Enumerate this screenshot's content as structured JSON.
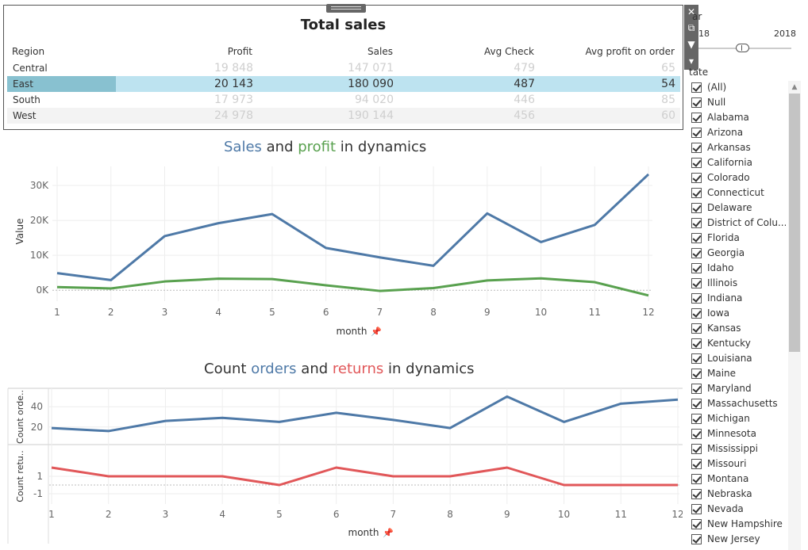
{
  "table": {
    "title": "Total sales",
    "headers": {
      "region": "Region",
      "profit": "Profit",
      "sales": "Sales",
      "avg_check": "Avg Check",
      "avg_profit": "Avg profit on order"
    },
    "rows": [
      {
        "region": "Central",
        "profit": "19 848",
        "sales": "147 071",
        "avg_check": "479",
        "avg_profit": "65"
      },
      {
        "region": "East",
        "profit": "20 143",
        "sales": "180 090",
        "avg_check": "487",
        "avg_profit": "54"
      },
      {
        "region": "South",
        "profit": "17 973",
        "sales": "94 020",
        "avg_check": "446",
        "avg_profit": "85"
      },
      {
        "region": "West",
        "profit": "24 978",
        "sales": "190 144",
        "avg_check": "456",
        "avg_profit": "60"
      }
    ],
    "selected_row": "East"
  },
  "tools": {
    "close": "✕",
    "popout": "⧉",
    "filter": "▼",
    "menu": "▾"
  },
  "filters": {
    "year_label": "ar",
    "year_min": "18",
    "year_max": "2018",
    "state_label": "tate",
    "states": [
      "(All)",
      "Null",
      "Alabama",
      "Arizona",
      "Arkansas",
      "California",
      "Colorado",
      "Connecticut",
      "Delaware",
      "District of Colu...",
      "Florida",
      "Georgia",
      "Idaho",
      "Illinois",
      "Indiana",
      "Iowa",
      "Kansas",
      "Kentucky",
      "Louisiana",
      "Maine",
      "Maryland",
      "Massachusetts",
      "Michigan",
      "Minnesota",
      "Mississippi",
      "Missouri",
      "Montana",
      "Nebraska",
      "Nevada",
      "New Hampshire",
      "New Jersey"
    ]
  },
  "chart1_title": {
    "sales": "Sales",
    "and": " and ",
    "profit": "profit",
    "rest": " in dynamics"
  },
  "chart2_title": {
    "count": "Count ",
    "orders": "orders",
    "and": " and ",
    "returns": "returns",
    "rest": " in dynamics"
  },
  "colors": {
    "blue": "#4e79a7",
    "green": "#59a14f",
    "red": "#e15759"
  },
  "chart_data": [
    {
      "type": "line",
      "xlabel": "month",
      "ylabel": "Value",
      "x": [
        1,
        2,
        3,
        4,
        5,
        6,
        7,
        8,
        9,
        10,
        11,
        12
      ],
      "y_ticks": [
        "0K",
        "10K",
        "20K",
        "30K"
      ],
      "ylim": [
        -2000,
        35000
      ],
      "series": [
        {
          "name": "Sales",
          "values": [
            4900,
            2900,
            15500,
            19200,
            21800,
            12100,
            9400,
            7000,
            22000,
            13800,
            18700,
            33200
          ]
        },
        {
          "name": "profit",
          "values": [
            900,
            500,
            2500,
            3300,
            3200,
            1400,
            -200,
            600,
            2800,
            3400,
            2300,
            -1500
          ]
        }
      ]
    },
    {
      "type": "line",
      "xlabel": "month",
      "x": [
        1,
        2,
        3,
        4,
        5,
        6,
        7,
        8,
        9,
        10,
        11,
        12
      ],
      "panels": [
        {
          "name": "orders",
          "ylabel": "Count orde..",
          "y_ticks": [
            "20",
            "40"
          ],
          "ylim": [
            5,
            55
          ],
          "values": [
            19,
            16,
            26,
            29,
            25,
            34,
            27,
            19,
            50,
            25,
            43,
            47
          ]
        },
        {
          "name": "returns",
          "ylabel": "Count retu..",
          "y_ticks": [
            "-1",
            "1"
          ],
          "ylim": [
            -2,
            4
          ],
          "values": [
            2,
            1,
            1,
            1,
            0,
            2,
            1,
            1,
            2,
            0,
            0,
            0
          ]
        }
      ]
    }
  ]
}
